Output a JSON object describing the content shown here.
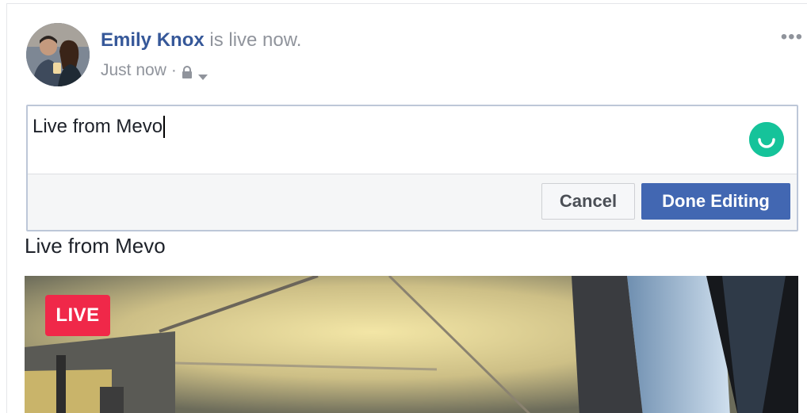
{
  "post": {
    "author": "Emily Knox",
    "status_text": " is live now.",
    "timestamp": "Just now",
    "separator": "·",
    "more_label": "•••"
  },
  "editor": {
    "value": "Live from Mevo",
    "cancel_label": "Cancel",
    "done_label": "Done Editing"
  },
  "content": {
    "text": "Live from Mevo"
  },
  "video": {
    "live_label": "LIVE"
  },
  "colors": {
    "author": "#365899",
    "primary_button": "#4267b2",
    "live_badge": "#f02849",
    "grammarly": "#15c39a"
  },
  "icons": {
    "privacy": "lock-icon",
    "audience_dropdown": "chevron-down-icon",
    "more": "more-options-icon",
    "grammarly": "grammarly-icon"
  }
}
